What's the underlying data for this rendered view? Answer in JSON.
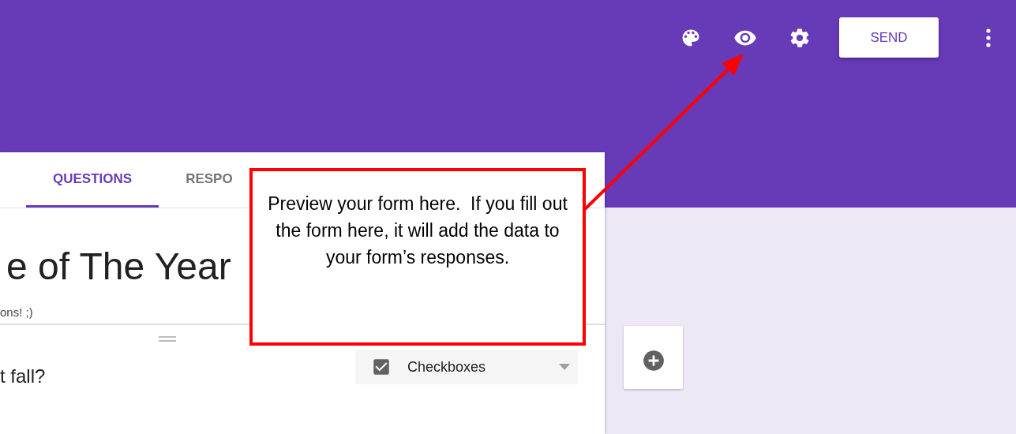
{
  "toolbar": {
    "send_button": "SEND"
  },
  "tabs": [
    {
      "label": "QUESTIONS",
      "selected": true
    },
    {
      "label": "RESPO",
      "selected": false
    }
  ],
  "form": {
    "title": "e of The Year",
    "description": "ons! ;)"
  },
  "question": {
    "title": "t fall?",
    "type_dropdown": "Checkboxes"
  },
  "callout": {
    "text": "Preview your form here.  If you fill out the form here, it will add the data to your form’s responses."
  }
}
